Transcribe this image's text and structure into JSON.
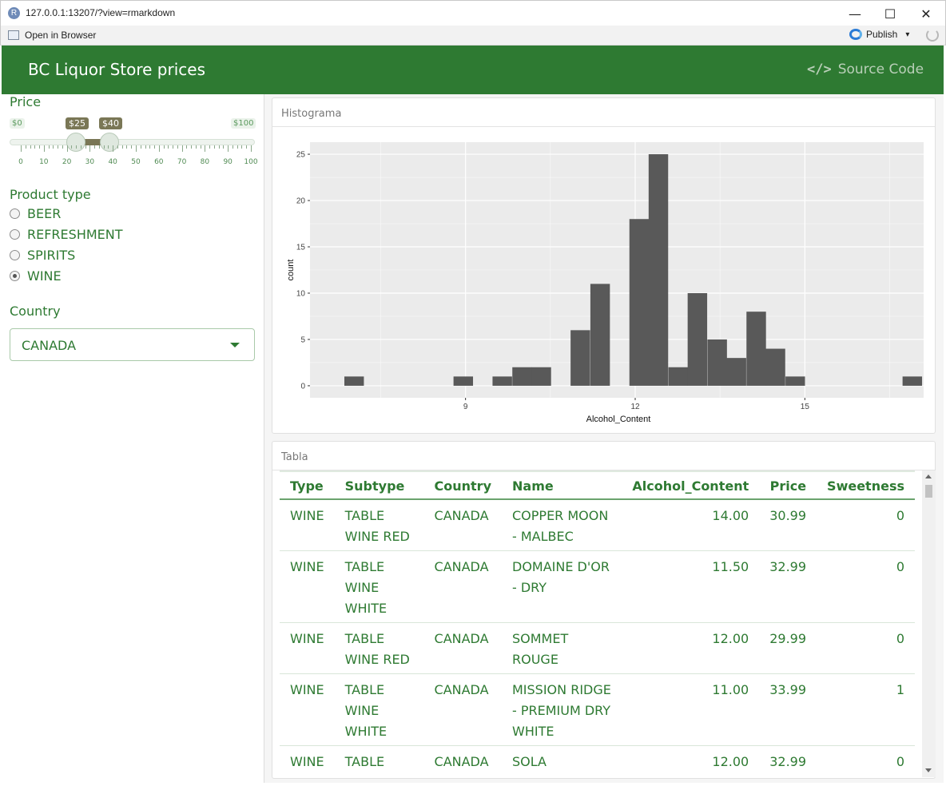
{
  "window": {
    "url": "127.0.0.1:13207/?view=rmarkdown",
    "app_icon": "R",
    "minimize_glyph": "—",
    "maximize_glyph": "☐",
    "close_glyph": "✕"
  },
  "toolbar": {
    "open_browser": "Open in Browser",
    "publish": "Publish",
    "publish_caret": "▾"
  },
  "navbar": {
    "brand": "BC Liquor Store prices",
    "source_code": "Source Code",
    "code_icon": "</>"
  },
  "sidebar": {
    "price_label": "Price",
    "slider": {
      "min_label": "$0",
      "max_label": "$100",
      "from_label": "$25",
      "to_label": "$40",
      "min": 0,
      "max": 100,
      "from": 25,
      "to": 40,
      "tick_labels": [
        "0",
        "10",
        "20",
        "30",
        "40",
        "50",
        "60",
        "70",
        "80",
        "90",
        "100"
      ]
    },
    "product_type_label": "Product type",
    "product_types": [
      {
        "label": "BEER",
        "checked": false
      },
      {
        "label": "REFRESHMENT",
        "checked": false
      },
      {
        "label": "SPIRITS",
        "checked": false
      },
      {
        "label": "WINE",
        "checked": true
      }
    ],
    "country_label": "Country",
    "country_value": "CANADA"
  },
  "histogram": {
    "header": "Histograma",
    "chart_data": {
      "type": "bar",
      "xlabel": "Alcohol_Content",
      "ylabel": "count",
      "xlim": [
        6.25,
        17.1
      ],
      "ylim": [
        -1.3,
        26.3
      ],
      "x_ticks": [
        "9",
        "12",
        "15"
      ],
      "y_ticks": [
        "0",
        "5",
        "10",
        "15",
        "20",
        "25"
      ],
      "bin_width": 0.345,
      "bin_centers": [
        7.03,
        8.96,
        9.65,
        10.0,
        10.34,
        11.03,
        11.38,
        12.07,
        12.41,
        12.76,
        13.1,
        13.45,
        13.79,
        14.14,
        14.48,
        14.83,
        16.9
      ],
      "counts": [
        1,
        1,
        1,
        2,
        2,
        6,
        11,
        18,
        25,
        2,
        10,
        5,
        3,
        8,
        4,
        1,
        1
      ],
      "grid": true,
      "background": "#ebebeb",
      "bar_color": "#595959"
    }
  },
  "table": {
    "header": "Tabla",
    "columns": [
      "Type",
      "Subtype",
      "Country",
      "Name",
      "Alcohol_Content",
      "Price",
      "Sweetness"
    ],
    "rows": [
      [
        "WINE",
        "TABLE WINE RED",
        "CANADA",
        "COPPER MOON - MALBEC",
        "14.00",
        "30.99",
        "0"
      ],
      [
        "WINE",
        "TABLE WINE WHITE",
        "CANADA",
        "DOMAINE D'OR - DRY",
        "11.50",
        "32.99",
        "0"
      ],
      [
        "WINE",
        "TABLE WINE RED",
        "CANADA",
        "SOMMET ROUGE",
        "12.00",
        "29.99",
        "0"
      ],
      [
        "WINE",
        "TABLE WINE WHITE",
        "CANADA",
        "MISSION RIDGE - PREMIUM DRY WHITE",
        "11.00",
        "33.99",
        "1"
      ],
      [
        "WINE",
        "TABLE WINE WHITE",
        "CANADA",
        "SOLA",
        "12.00",
        "32.99",
        "0"
      ]
    ]
  },
  "colors": {
    "accent": "#2e7a32",
    "slider_range": "#7a7756"
  }
}
